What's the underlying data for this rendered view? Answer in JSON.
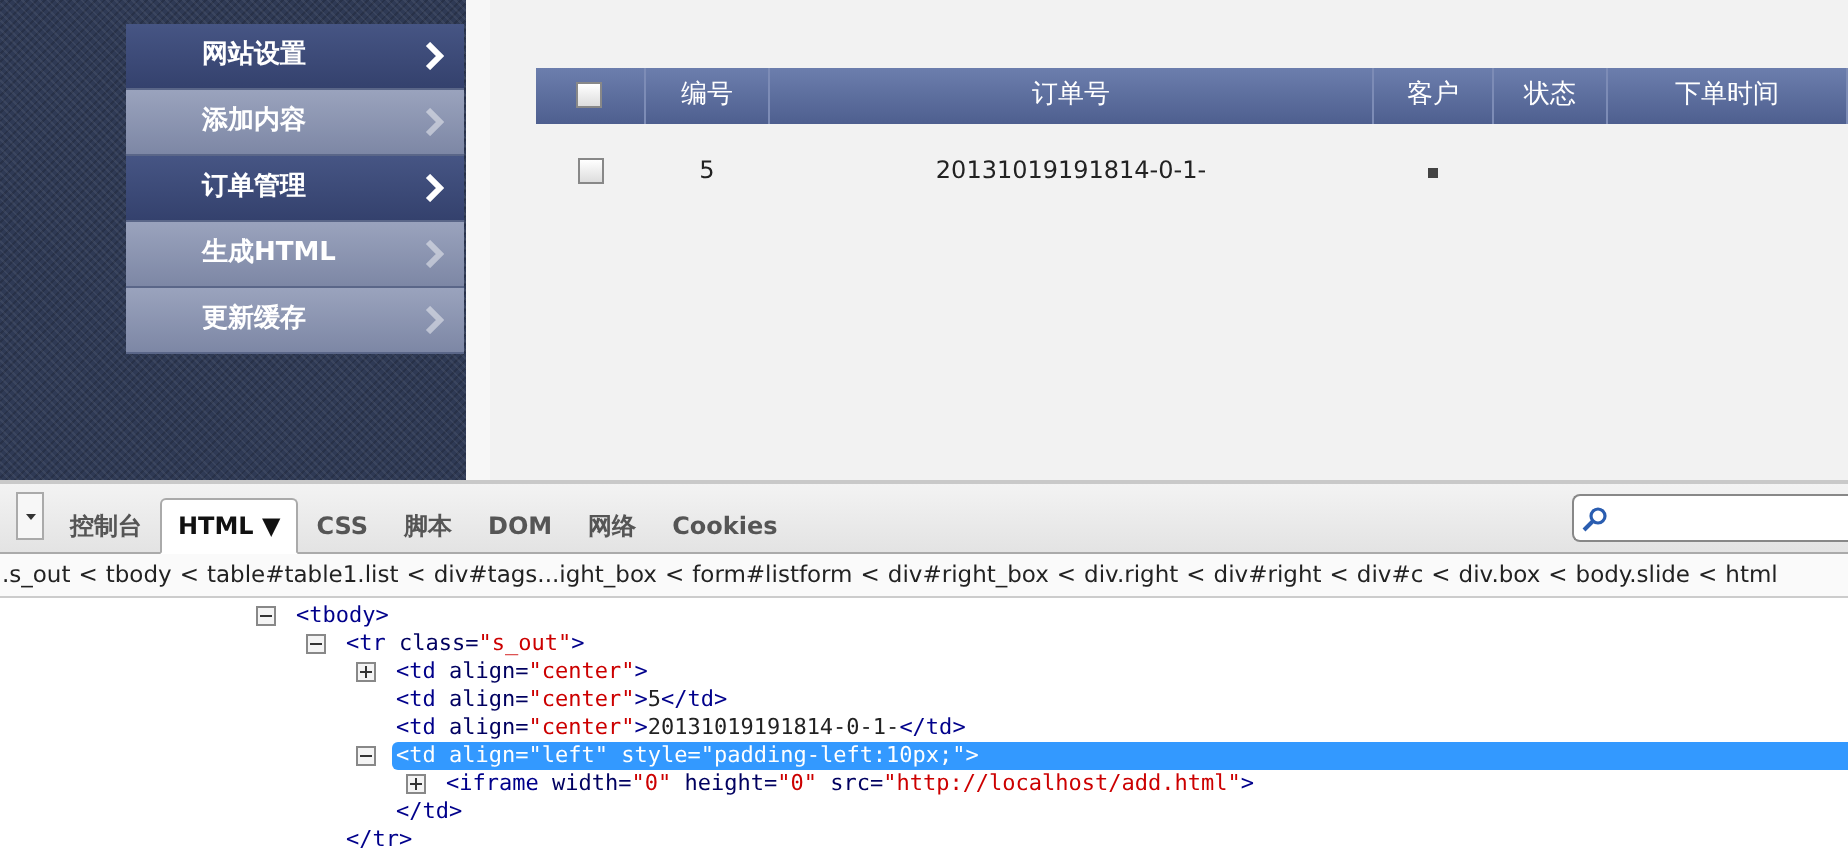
{
  "menu": [
    {
      "label": "网站设置",
      "selected": true
    },
    {
      "label": "添加内容",
      "selected": false
    },
    {
      "label": "订单管理",
      "selected": true
    },
    {
      "label": "生成HTML",
      "selected": false
    },
    {
      "label": "更新缓存",
      "selected": false
    }
  ],
  "table": {
    "header_checkbox": {
      "checked": false
    },
    "columns": [
      "编号",
      "订单号",
      "客户",
      "状态",
      "下单时间"
    ],
    "rows": [
      {
        "checked": false,
        "cells": [
          "5",
          "20131019191814-0-1-"
        ]
      }
    ]
  },
  "devtools": {
    "tabs": [
      {
        "label": "控制台",
        "selected": false
      },
      {
        "label": "HTML",
        "selected": true,
        "dropdown": "▼"
      },
      {
        "label": "CSS",
        "selected": false
      },
      {
        "label": "脚本",
        "selected": false
      },
      {
        "label": "DOM",
        "selected": false
      },
      {
        "label": "网络",
        "selected": false
      },
      {
        "label": "Cookies",
        "selected": false
      }
    ],
    "breadcrumbs": [
      ".s_out",
      "tbody",
      "table#table1.list",
      "div#tags...ight_box",
      "form#listform",
      "div#right_box",
      "div.right",
      "div#right",
      "div#c",
      "div.box",
      "body.slide",
      "html"
    ],
    "breadcrumb_separator": "<",
    "tree": [
      {
        "text": "<tbody>",
        "expanded": true,
        "selected": false,
        "children": [
          {
            "text": "<tr class=\"s_out\">",
            "expanded": true,
            "selected": false,
            "close": "</tr>",
            "children": [
              {
                "text": "<td align=\"center\">",
                "expanded": false,
                "selected": false
              },
              {
                "text": "<td align=\"center\">5</td>",
                "selected": false
              },
              {
                "text": "<td align=\"center\">20131019191814-0-1-</td>",
                "selected": false
              },
              {
                "text": "<td align=\"left\" style=\"padding-left:10px;\">",
                "expanded": true,
                "selected": true,
                "close": "</td>",
                "children": [
                  {
                    "text": "<iframe width=\"0\" height=\"0\" src=\"http://localhost/add.html\">",
                    "expanded": false,
                    "selected": false
                  }
                ]
              }
            ]
          }
        ]
      }
    ]
  }
}
